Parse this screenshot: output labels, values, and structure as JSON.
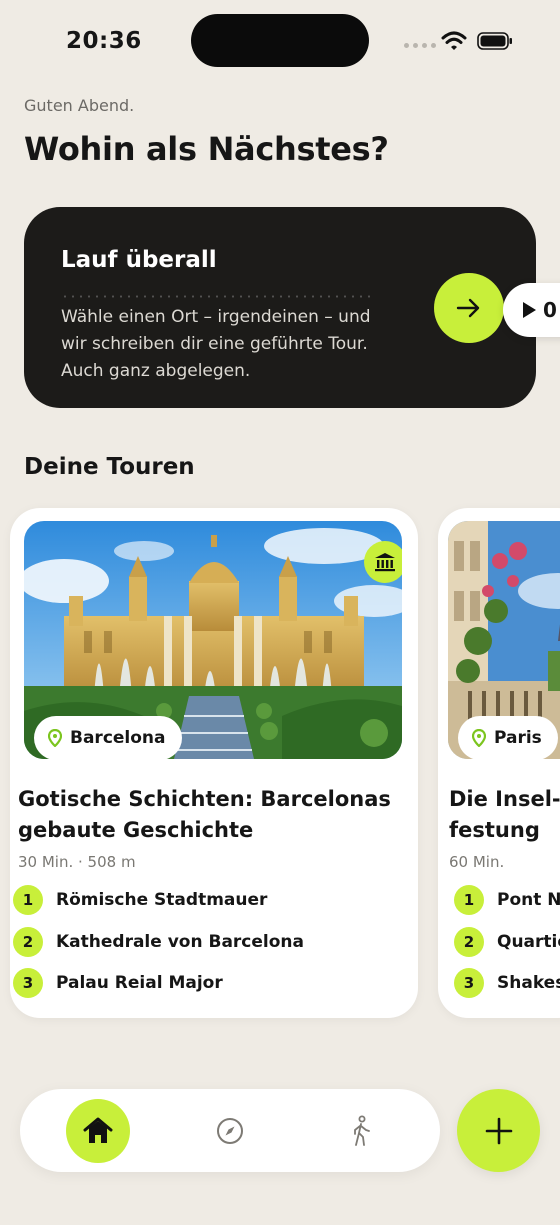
{
  "status_bar": {
    "time": "20:36"
  },
  "header": {
    "greeting": "Guten Abend.",
    "title": "Wohin als Nächstes?"
  },
  "hero": {
    "title": "Lauf überall",
    "text": "Wähle einen Ort – irgendeinen – und wir schreiben dir eine geführte Tour. Auch ganz abgelegen.",
    "arrow_icon": "arrow-right-icon",
    "player_label": "0"
  },
  "tours_section": {
    "title": "Deine Touren"
  },
  "tours": [
    {
      "city": "Barcelona",
      "title": "Gotische Schichten: Barcelonas gebaute Geschichte",
      "meta": "30 Min. · 508 m",
      "category_icon": "museum-icon",
      "stops": [
        "Römische Stadtmauer",
        "Kathedrale von Barcelona",
        "Palau Reial Major"
      ]
    },
    {
      "city": "Paris",
      "title": "Die Insel-festung",
      "meta": "60 Min.",
      "stops": [
        "Pont Ne",
        "Quartie",
        "Shakes"
      ]
    }
  ],
  "nav": {
    "items": [
      "home-icon",
      "compass-icon",
      "walking-icon"
    ],
    "fab_icon": "plus-icon"
  },
  "colors": {
    "accent": "#c8ef3a",
    "background": "#efebe4",
    "dark_card": "#1c1b19"
  }
}
